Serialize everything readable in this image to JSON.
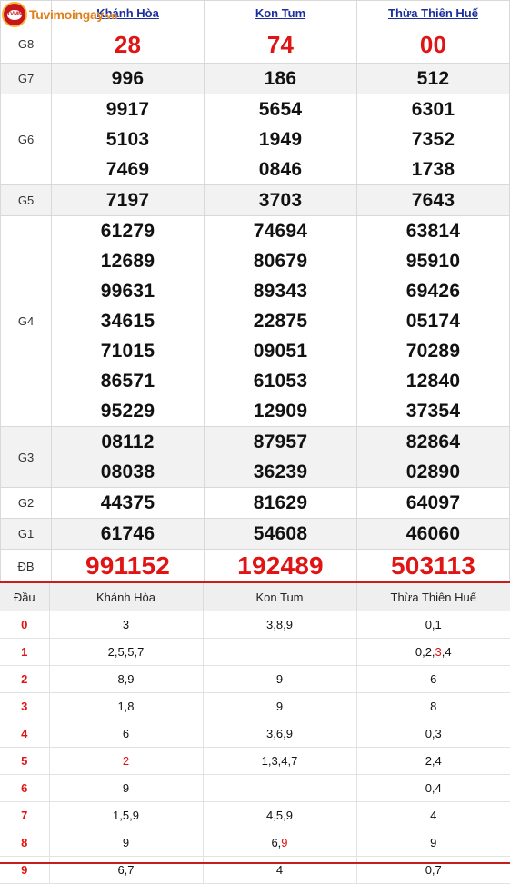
{
  "logo": {
    "name": "Tuvimoingay",
    "suffix": ".vn",
    "badge": "TVMN"
  },
  "provinces": [
    "Khánh Hòa",
    "Kon Tum",
    "Thừa Thiên Huế"
  ],
  "prizes": [
    {
      "label": "G8",
      "values": [
        [
          "28"
        ],
        [
          "74"
        ],
        [
          "00"
        ]
      ]
    },
    {
      "label": "G7",
      "values": [
        [
          "996"
        ],
        [
          "186"
        ],
        [
          "512"
        ]
      ]
    },
    {
      "label": "G6",
      "values": [
        [
          "9917",
          "5103",
          "7469"
        ],
        [
          "5654",
          "1949",
          "0846"
        ],
        [
          "6301",
          "7352",
          "1738"
        ]
      ]
    },
    {
      "label": "G5",
      "values": [
        [
          "7197"
        ],
        [
          "3703"
        ],
        [
          "7643"
        ]
      ]
    },
    {
      "label": "G4",
      "values": [
        [
          "61279",
          "12689",
          "99631",
          "34615",
          "71015",
          "86571",
          "95229"
        ],
        [
          "74694",
          "80679",
          "89343",
          "22875",
          "09051",
          "61053",
          "12909"
        ],
        [
          "63814",
          "95910",
          "69426",
          "05174",
          "70289",
          "12840",
          "37354"
        ]
      ]
    },
    {
      "label": "G3",
      "values": [
        [
          "08112",
          "08038"
        ],
        [
          "87957",
          "36239"
        ],
        [
          "82864",
          "02890"
        ]
      ]
    },
    {
      "label": "G2",
      "values": [
        [
          "44375"
        ],
        [
          "81629"
        ],
        [
          "64097"
        ]
      ]
    },
    {
      "label": "G1",
      "values": [
        [
          "61746"
        ],
        [
          "54608"
        ],
        [
          "46060"
        ]
      ]
    },
    {
      "label": "ĐB",
      "values": [
        [
          "991152"
        ],
        [
          "192489"
        ],
        [
          "503113"
        ]
      ]
    }
  ],
  "loto": {
    "head_label": "Đầu",
    "columns": [
      "Khánh Hòa",
      "Kon Tum",
      "Thừa Thiên Huế"
    ],
    "rows": [
      {
        "dau": "0",
        "cells": [
          [
            [
              "3",
              false
            ]
          ],
          [
            [
              "3,8,9",
              false
            ]
          ],
          [
            [
              "0,1",
              false
            ]
          ]
        ]
      },
      {
        "dau": "1",
        "cells": [
          [
            [
              "2,5,5,7",
              false
            ]
          ],
          [
            [
              "",
              false
            ]
          ],
          [
            [
              "0,2,",
              false
            ],
            [
              "3",
              true
            ],
            [
              ",4",
              false
            ]
          ]
        ]
      },
      {
        "dau": "2",
        "cells": [
          [
            [
              "8,9",
              false
            ]
          ],
          [
            [
              "9",
              false
            ]
          ],
          [
            [
              "6",
              false
            ]
          ]
        ]
      },
      {
        "dau": "3",
        "cells": [
          [
            [
              "1,8",
              false
            ]
          ],
          [
            [
              "9",
              false
            ]
          ],
          [
            [
              "8",
              false
            ]
          ]
        ]
      },
      {
        "dau": "4",
        "cells": [
          [
            [
              "6",
              false
            ]
          ],
          [
            [
              "3,6,9",
              false
            ]
          ],
          [
            [
              "0,3",
              false
            ]
          ]
        ]
      },
      {
        "dau": "5",
        "cells": [
          [
            [
              "2",
              true
            ]
          ],
          [
            [
              "1,3,4,7",
              false
            ]
          ],
          [
            [
              "2,4",
              false
            ]
          ]
        ]
      },
      {
        "dau": "6",
        "cells": [
          [
            [
              "9",
              false
            ]
          ],
          [
            [
              "",
              false
            ]
          ],
          [
            [
              "0,4",
              false
            ]
          ]
        ]
      },
      {
        "dau": "7",
        "cells": [
          [
            [
              "1,5,9",
              false
            ]
          ],
          [
            [
              "4,5,9",
              false
            ]
          ],
          [
            [
              "4",
              false
            ]
          ]
        ]
      },
      {
        "dau": "8",
        "cells": [
          [
            [
              "9",
              false
            ]
          ],
          [
            [
              "6,",
              false
            ],
            [
              "9",
              true
            ]
          ],
          [
            [
              "9",
              false
            ]
          ]
        ]
      },
      {
        "dau": "9",
        "cells": [
          [
            [
              "6,7",
              false
            ]
          ],
          [
            [
              "4",
              false
            ]
          ],
          [
            [
              "0,7",
              false
            ]
          ]
        ]
      }
    ]
  },
  "colors": {
    "accent_red": "#e01414",
    "link_blue": "#1b2f9c",
    "logo_orange": "#e0801a"
  }
}
